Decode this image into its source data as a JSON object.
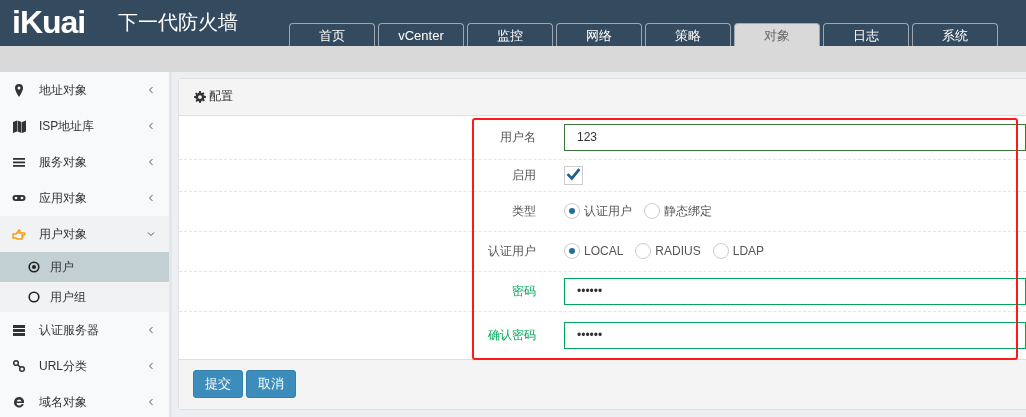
{
  "header": {
    "logo": "iKuai",
    "title": "下一代防火墙"
  },
  "tabs": [
    {
      "label": "首页",
      "selected": false
    },
    {
      "label": "vCenter",
      "selected": false
    },
    {
      "label": "监控",
      "selected": false
    },
    {
      "label": "网络",
      "selected": false
    },
    {
      "label": "策略",
      "selected": false
    },
    {
      "label": "对象",
      "selected": true
    },
    {
      "label": "日志",
      "selected": false
    },
    {
      "label": "系统",
      "selected": false
    }
  ],
  "sidebar": {
    "items": [
      {
        "label": "地址对象",
        "expanded": false
      },
      {
        "label": "ISP地址库",
        "expanded": false
      },
      {
        "label": "服务对象",
        "expanded": false
      },
      {
        "label": "应用对象",
        "expanded": false
      },
      {
        "label": "用户对象",
        "expanded": true,
        "children": [
          {
            "label": "用户",
            "selected": true
          },
          {
            "label": "用户组",
            "selected": false
          }
        ]
      },
      {
        "label": "认证服务器",
        "expanded": false
      },
      {
        "label": "URL分类",
        "expanded": false
      },
      {
        "label": "域名对象",
        "expanded": false
      }
    ]
  },
  "panel": {
    "title": "配置",
    "rows": [
      {
        "kind": "text",
        "label": "用户名",
        "value": "123",
        "focused": true,
        "valid": false
      },
      {
        "kind": "checkbox",
        "label": "启用",
        "checked": true
      },
      {
        "kind": "radio",
        "label": "类型",
        "options": [
          {
            "label": "认证用户",
            "selected": true
          },
          {
            "label": "静态绑定",
            "selected": false
          }
        ]
      },
      {
        "kind": "radio",
        "label": "认证用户",
        "options": [
          {
            "label": "LOCAL",
            "selected": true
          },
          {
            "label": "RADIUS",
            "selected": false
          },
          {
            "label": "LDAP",
            "selected": false
          }
        ]
      },
      {
        "kind": "text",
        "label": "密码",
        "value": "••••••",
        "focused": false,
        "valid": true
      },
      {
        "kind": "text",
        "label": "确认密码",
        "value": "••••••",
        "focused": false,
        "valid": true
      }
    ],
    "buttons": [
      "提交",
      "取消"
    ]
  }
}
